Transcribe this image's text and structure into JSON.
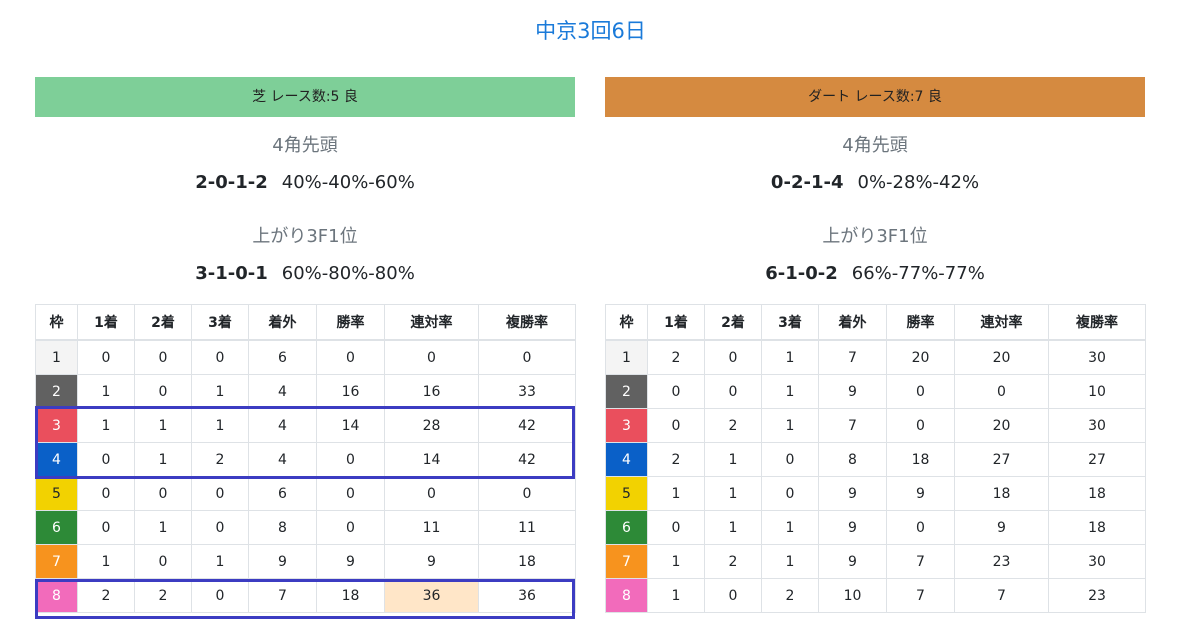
{
  "page": {
    "title": "中京3回6日"
  },
  "columns": [
    "枠",
    "1着",
    "2着",
    "3着",
    "着外",
    "勝率",
    "連対率",
    "複勝率"
  ],
  "turf": {
    "header": "芝 レース数:5  良",
    "lead": {
      "label": "4角先頭",
      "rec": [
        "2",
        "0",
        "1",
        "2"
      ],
      "pct": "40%-40%-60%"
    },
    "last3f": {
      "label": "上がり3F1位",
      "rec": [
        "3",
        "1",
        "0",
        "1"
      ],
      "pct": "60%-80%-80%"
    },
    "rows": [
      [
        "1",
        "0",
        "0",
        "0",
        "6",
        "0",
        "0",
        "0"
      ],
      [
        "2",
        "1",
        "0",
        "1",
        "4",
        "16",
        "16",
        "33"
      ],
      [
        "3",
        "1",
        "1",
        "1",
        "4",
        "14",
        "28",
        "42"
      ],
      [
        "4",
        "0",
        "1",
        "2",
        "4",
        "0",
        "14",
        "42"
      ],
      [
        "5",
        "0",
        "0",
        "0",
        "6",
        "0",
        "0",
        "0"
      ],
      [
        "6",
        "0",
        "1",
        "0",
        "8",
        "0",
        "11",
        "11"
      ],
      [
        "7",
        "1",
        "0",
        "1",
        "9",
        "9",
        "9",
        "18"
      ],
      [
        "8",
        "2",
        "2",
        "0",
        "7",
        "18",
        "36",
        "36"
      ]
    ]
  },
  "dirt": {
    "header": "ダート レース数:7  良",
    "lead": {
      "label": "4角先頭",
      "rec": [
        "0",
        "2",
        "1",
        "4"
      ],
      "pct": "0%-28%-42%"
    },
    "last3f": {
      "label": "上がり3F1位",
      "rec": [
        "6",
        "1",
        "0",
        "2"
      ],
      "pct": "66%-77%-77%"
    },
    "rows": [
      [
        "1",
        "2",
        "0",
        "1",
        "7",
        "20",
        "20",
        "30"
      ],
      [
        "2",
        "0",
        "0",
        "1",
        "9",
        "0",
        "0",
        "10"
      ],
      [
        "3",
        "0",
        "2",
        "1",
        "7",
        "0",
        "20",
        "30"
      ],
      [
        "4",
        "2",
        "1",
        "0",
        "8",
        "18",
        "27",
        "27"
      ],
      [
        "5",
        "1",
        "1",
        "0",
        "9",
        "9",
        "18",
        "18"
      ],
      [
        "6",
        "0",
        "1",
        "1",
        "9",
        "0",
        "9",
        "18"
      ],
      [
        "7",
        "1",
        "2",
        "1",
        "9",
        "7",
        "23",
        "30"
      ],
      [
        "8",
        "1",
        "0",
        "2",
        "10",
        "7",
        "7",
        "23"
      ]
    ]
  },
  "colors": {
    "waku": [
      "#f4f4f4",
      "#616161",
      "#ea4f5d",
      "#0a60c8",
      "#f2d201",
      "#2d8a37",
      "#f7931e",
      "#f26bbb"
    ],
    "turf_header": "#7ecf98",
    "dirt_header": "#d58a40",
    "title": "#1a7ad9",
    "highlight_frame": "#3c3cc2",
    "highlight_cell": "#ffe6c8"
  }
}
